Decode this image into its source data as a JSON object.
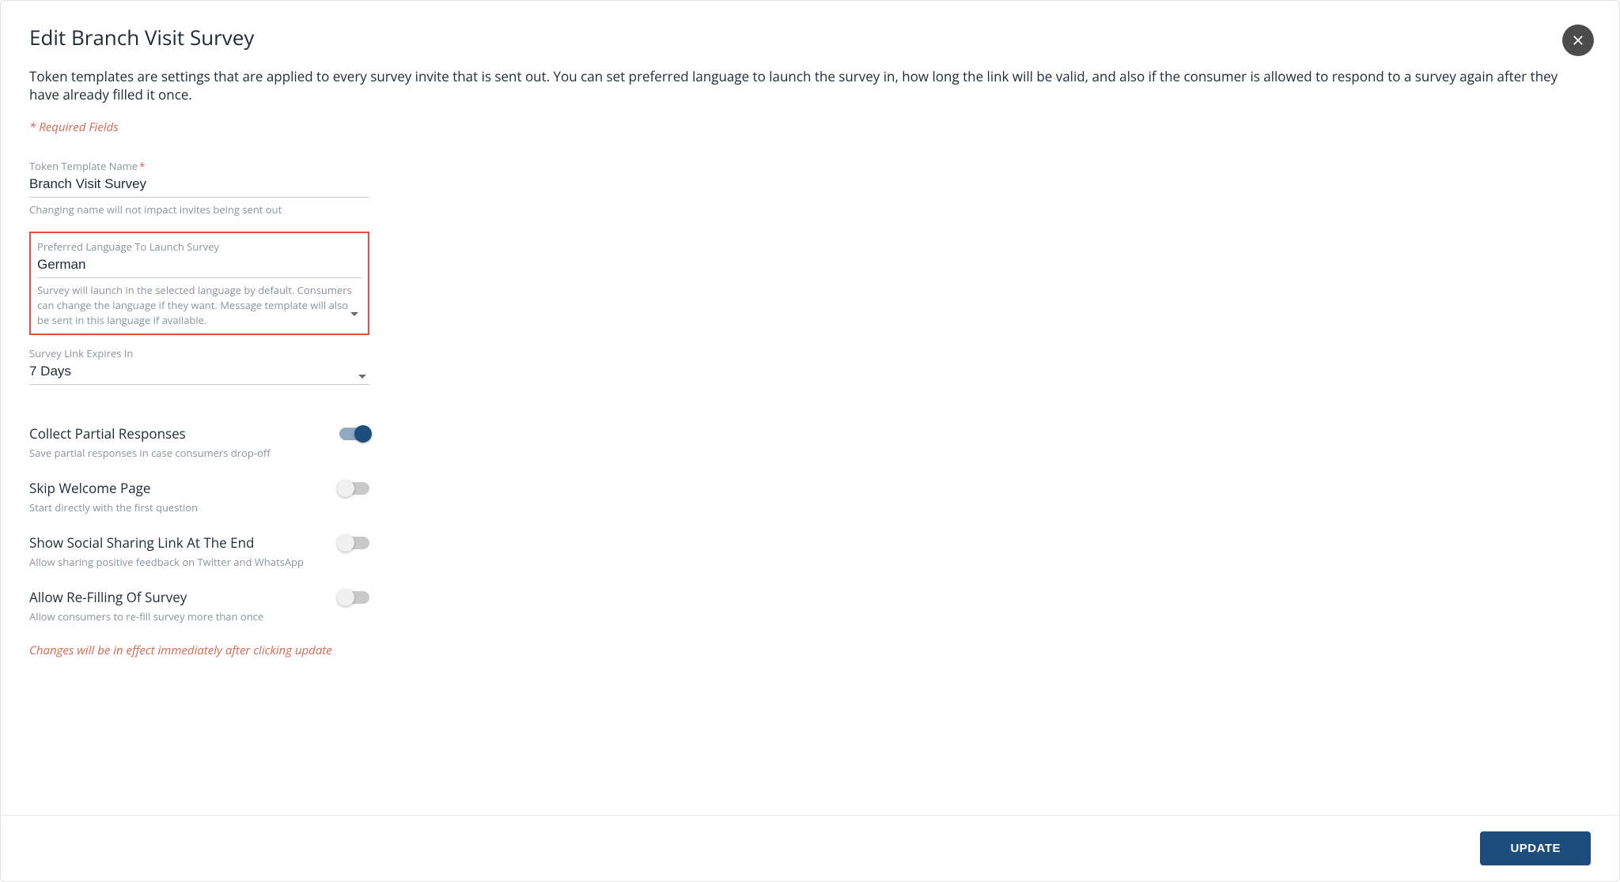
{
  "header": {
    "title": "Edit Branch Visit Survey",
    "intro": "Token templates are settings that are applied to every survey invite that is sent out. You can set preferred language to launch the survey in, how long the link will be valid, and also if the consumer is allowed to respond to a survey again after they have already filled it once.",
    "required_hint_prefix": "*",
    "required_hint": "Required Fields"
  },
  "fields": {
    "name": {
      "label": "Token Template Name",
      "required": true,
      "value": "Branch Visit Survey",
      "help": "Changing name will not impact invites being sent out"
    },
    "language": {
      "label": "Preferred Language To Launch Survey",
      "value": "German",
      "help": "Survey will launch in the selected language by default. Consumers can change the language if they want. Message template will also be sent in this language if available."
    },
    "expiry": {
      "label": "Survey Link Expires In",
      "value": "7 Days"
    }
  },
  "toggles": {
    "partial": {
      "title": "Collect Partial Responses",
      "help": "Save partial responses in case consumers drop-off",
      "on": true
    },
    "skip": {
      "title": "Skip Welcome Page",
      "help": "Start directly with the first question",
      "on": false
    },
    "sharing": {
      "title": "Show Social Sharing Link At The End",
      "help": "Allow sharing positive feedback on Twitter and WhatsApp",
      "on": false
    },
    "refill": {
      "title": "Allow Re-Filling Of Survey",
      "help": "Allow consumers to re-fill survey more than once",
      "on": false
    }
  },
  "effect_note": "Changes will be in effect immediately after clicking update",
  "footer": {
    "update_label": "UPDATE"
  }
}
